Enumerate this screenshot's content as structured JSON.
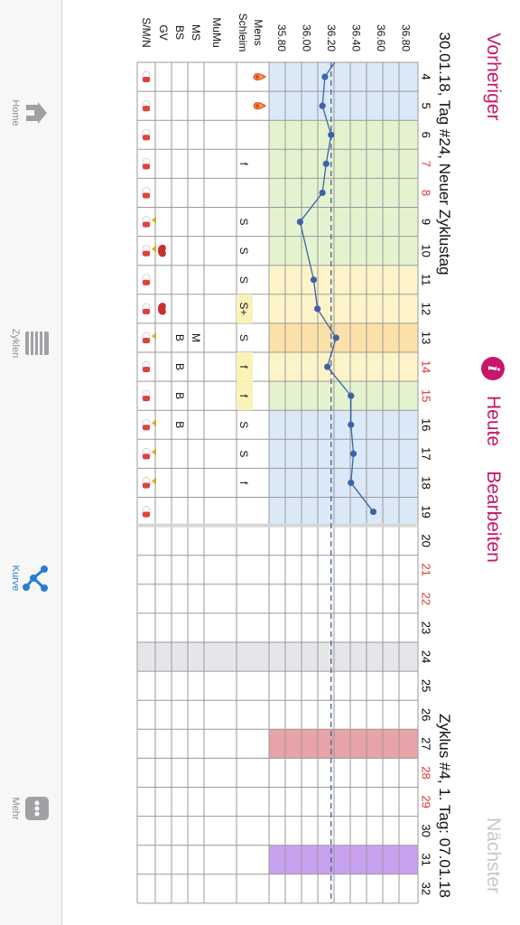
{
  "header": {
    "prev_label": "Vorheriger",
    "today_label": "Heute",
    "edit_label": "Bearbeiten",
    "next_label": "Nächster",
    "info_icon": "info-icon",
    "accent": "#c8176b"
  },
  "chart": {
    "day_info": "30.01.18, Tag #24, Neuer Zyklustag",
    "cycle_info": "Zyklus #4, 1. Tag: 07.01.18",
    "temp_ticks": [
      "36.80",
      "36.60",
      "36.40",
      "36.20",
      "36.00",
      "35.80"
    ],
    "row_labels": [
      "Mens",
      "Schleim",
      "MuMu",
      "MS",
      "BS",
      "GV",
      "S/M/N"
    ],
    "days": [
      "4",
      "5",
      "6",
      "7",
      "8",
      "9",
      "10",
      "11",
      "12",
      "13",
      "14",
      "15",
      "16",
      "17",
      "18",
      "19",
      "20",
      "21",
      "22",
      "23",
      "24",
      "25",
      "26",
      "27",
      "28",
      "29",
      "30",
      "31",
      "32"
    ],
    "weekend_days": [
      "7",
      "8",
      "14",
      "15",
      "21",
      "22",
      "28",
      "29"
    ],
    "day_number_colors": {
      "normal": "#000000",
      "weekend": "#e0322d"
    }
  },
  "chart_data": {
    "type": "line",
    "x": [
      4,
      5,
      6,
      7,
      8,
      9,
      10,
      11,
      12,
      13,
      14,
      15,
      16,
      17,
      18,
      19
    ],
    "y": [
      36.15,
      36.13,
      36.2,
      36.16,
      36.13,
      35.95,
      null,
      null,
      36.06,
      36.09,
      36.24,
      36.22,
      36.36,
      36.36,
      36.38,
      36.36,
      36.54
    ],
    "points": [
      {
        "day": 4,
        "temp": 36.15
      },
      {
        "day": 5,
        "temp": 36.13
      },
      {
        "day": 6,
        "temp": 36.2
      },
      {
        "day": 7,
        "temp": 36.16
      },
      {
        "day": 8,
        "temp": 36.13
      },
      {
        "day": 9,
        "temp": 35.95
      },
      {
        "day": 11,
        "temp": 36.06
      },
      {
        "day": 12,
        "temp": 36.09
      },
      {
        "day": 13,
        "temp": 36.24
      },
      {
        "day": 14,
        "temp": 36.17
      },
      {
        "day": 15,
        "temp": 36.36
      },
      {
        "day": 16,
        "temp": 36.36
      },
      {
        "day": 17,
        "temp": 36.38
      },
      {
        "day": 18,
        "temp": 36.36
      },
      {
        "day": 19,
        "temp": 36.54
      }
    ],
    "line_start_temp": 36.23,
    "coverline": 36.2,
    "ylim": [
      35.7,
      36.9
    ],
    "xlabel": "",
    "ylabel": ""
  },
  "rows": {
    "mens": {
      "4": "drop",
      "5": "drop"
    },
    "schleim": {
      "7": "f",
      "9": "S",
      "10": "S",
      "11": "S",
      "12": "S+",
      "13": "S",
      "14": "f",
      "15": "f",
      "16": "S",
      "17": "S",
      "18": "f"
    },
    "ms": {
      "13": "M"
    },
    "bs": {
      "13": "B",
      "14": "B",
      "15": "B",
      "16": "B"
    },
    "gv": {
      "10": "heart",
      "12": "heart"
    }
  },
  "bands": [
    {
      "from": 4,
      "to": 5,
      "color": "#dbe8f7"
    },
    {
      "from": 6,
      "to": 10,
      "color": "#e4f3cf"
    },
    {
      "from": 11,
      "to": 12,
      "color": "#fcf4c8"
    },
    {
      "from": 13,
      "to": 13,
      "color": "#fbe0a9"
    },
    {
      "from": 14,
      "to": 14,
      "color": "#fcf4c8"
    },
    {
      "from": 15,
      "to": 15,
      "color": "#e4f3cf"
    },
    {
      "from": 16,
      "to": 19,
      "color": "#dbe8f7"
    }
  ],
  "markers": [
    {
      "day": 24,
      "color": "#e6e6ea"
    },
    {
      "day": 27,
      "color": "#e6a3a8"
    },
    {
      "day": 31,
      "color": "#c8a2ef"
    }
  ],
  "tabs": [
    {
      "label": "Home",
      "icon": "home-icon"
    },
    {
      "label": "Zyklen",
      "icon": "list-icon"
    },
    {
      "label": "Kurve",
      "icon": "chart-icon"
    },
    {
      "label": "Mehr",
      "icon": "more-icon"
    }
  ]
}
